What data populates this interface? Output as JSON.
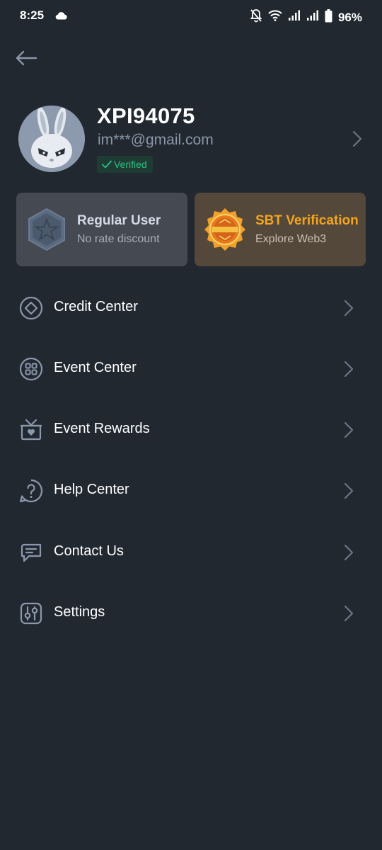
{
  "status_bar": {
    "time": "8:25",
    "battery_percent": "96%",
    "icons": [
      "cloud-icon",
      "notifications-off-icon",
      "wifi-icon",
      "signal-icon",
      "signal-icon",
      "battery-icon"
    ]
  },
  "header": {
    "back_icon": "arrow-left-icon"
  },
  "profile": {
    "username": "XPI94075",
    "email": "im***@gmail.com",
    "verified_label": "Verified"
  },
  "cards": {
    "regular": {
      "title": "Regular User",
      "subtitle": "No rate discount"
    },
    "sbt": {
      "title": "SBT Verification",
      "subtitle": "Explore Web3"
    }
  },
  "menu": {
    "items": [
      {
        "label": "Credit Center",
        "icon": "credit-center-icon"
      },
      {
        "label": "Event Center",
        "icon": "event-center-icon"
      },
      {
        "label": "Event Rewards",
        "icon": "event-rewards-icon"
      },
      {
        "label": "Help Center",
        "icon": "help-center-icon"
      },
      {
        "label": "Contact Us",
        "icon": "contact-us-icon"
      },
      {
        "label": "Settings",
        "icon": "settings-icon"
      }
    ]
  },
  "colors": {
    "background": "#222830",
    "accent_green": "#2fbf84",
    "accent_orange": "#f4a51f",
    "muted_text": "#8a96a8"
  }
}
